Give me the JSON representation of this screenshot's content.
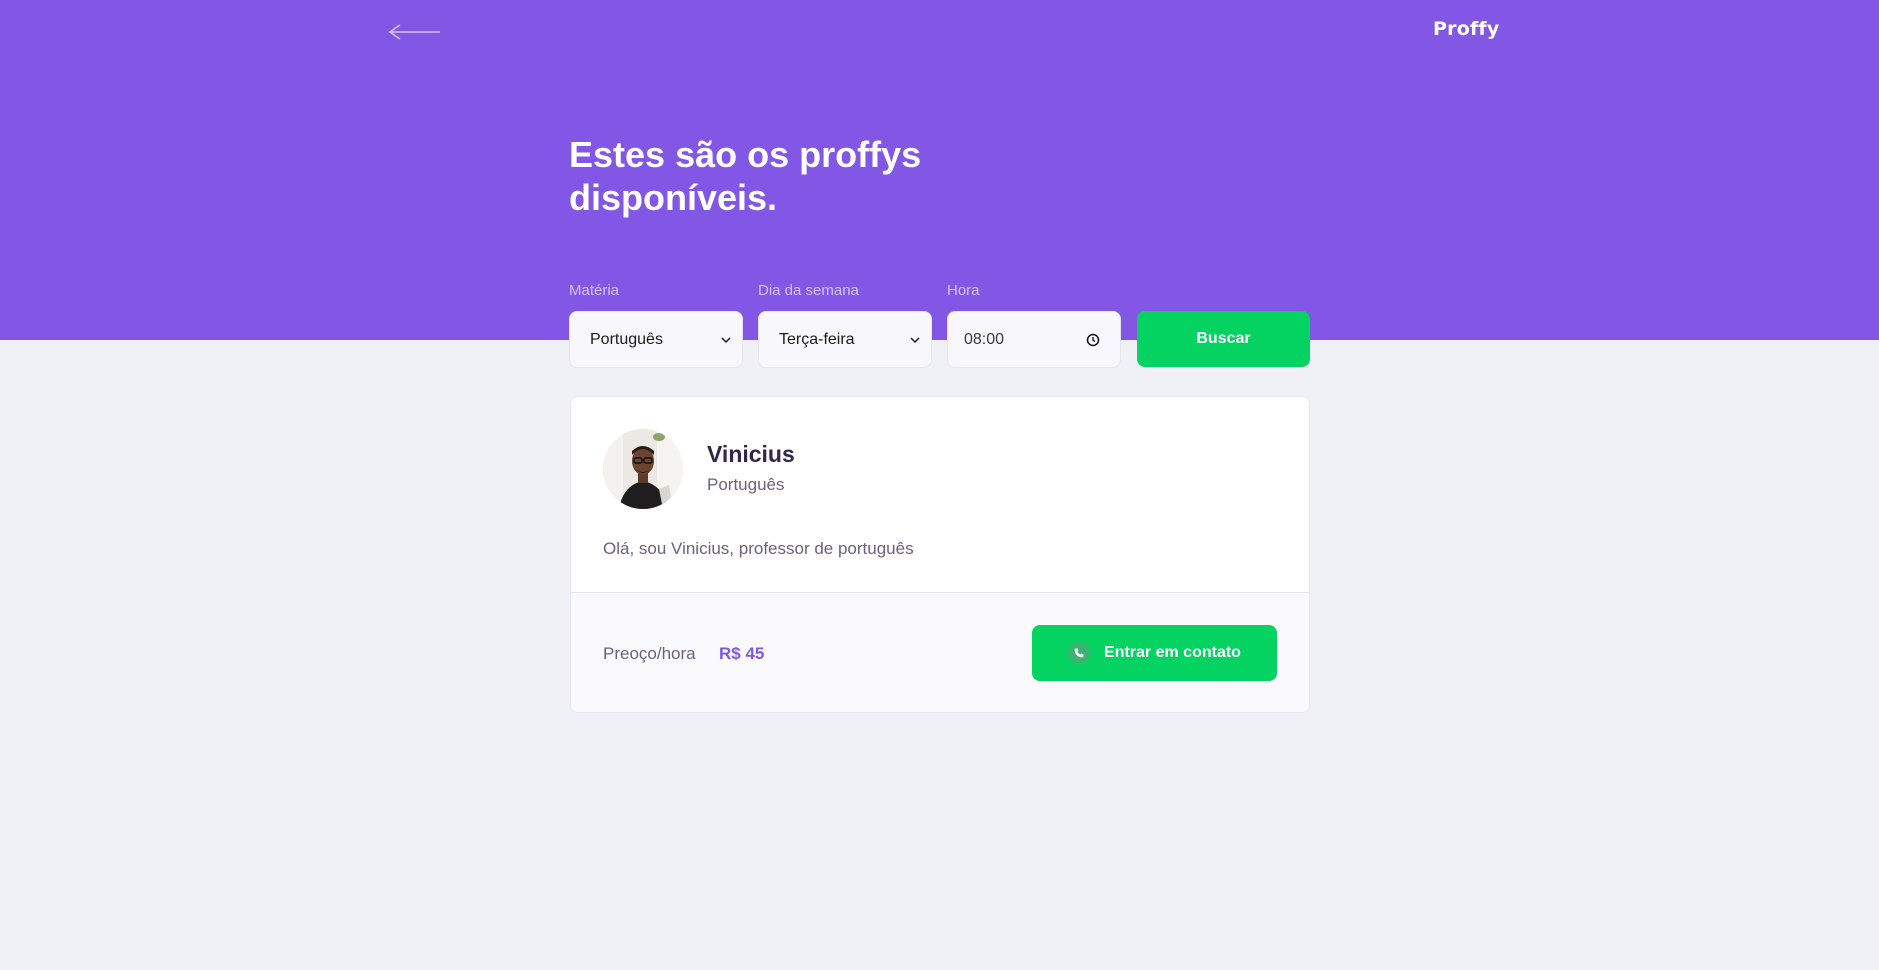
{
  "header": {
    "logo": "Proffy",
    "title": "Estes são os proffys disponíveis.",
    "background_color": "#8257E5"
  },
  "filters": {
    "subject": {
      "label": "Matéria",
      "value": "Português"
    },
    "weekday": {
      "label": "Dia da semana",
      "value": "Terça-feira"
    },
    "time": {
      "label": "Hora",
      "value": "08:00"
    },
    "search_label": "Buscar"
  },
  "teachers": [
    {
      "name": "Vinicius",
      "subject": "Português",
      "bio": "Olá, sou Vinicius, professor de português",
      "price_label": "Preoço/hora",
      "price": "R$ 45",
      "contact_label": "Entrar em contato"
    }
  ],
  "icons": {
    "back": "arrow-left-icon",
    "dropdown": "chevron-down-icon",
    "clock": "clock-icon",
    "whatsapp": "whatsapp-icon"
  },
  "colors": {
    "primary": "#8257E5",
    "secondary": "#04D361",
    "background": "#F0F0F7",
    "title_text": "#32264D"
  }
}
